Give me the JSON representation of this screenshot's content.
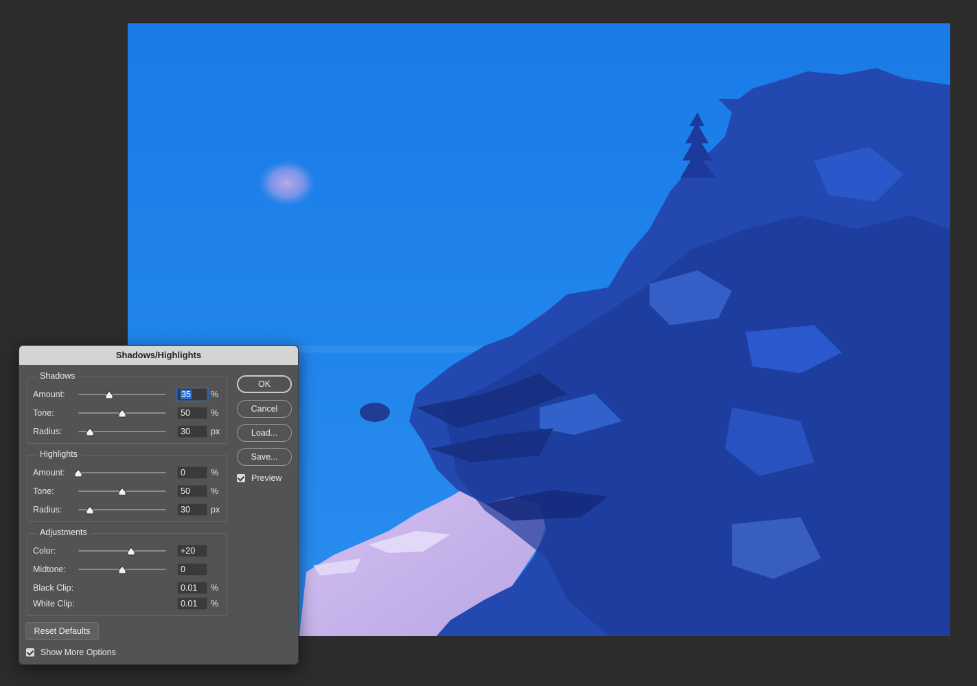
{
  "dialog": {
    "title": "Shadows/Highlights",
    "buttons": {
      "ok": "OK",
      "cancel": "Cancel",
      "load": "Load...",
      "save": "Save..."
    },
    "preview": {
      "label": "Preview",
      "checked": true
    },
    "reset_defaults": "Reset Defaults",
    "show_more_options": {
      "label": "Show More Options",
      "checked": true
    }
  },
  "shadows": {
    "label": "Shadows",
    "amount": {
      "label": "Amount:",
      "value": "35",
      "unit": "%",
      "slider_fraction": 0.35
    },
    "tone": {
      "label": "Tone:",
      "value": "50",
      "unit": "%",
      "slider_fraction": 0.5
    },
    "radius": {
      "label": "Radius:",
      "value": "30",
      "unit": "px",
      "slider_fraction": 0.13
    }
  },
  "highlights": {
    "label": "Highlights",
    "amount": {
      "label": "Amount:",
      "value": "0",
      "unit": "%",
      "slider_fraction": 0.0
    },
    "tone": {
      "label": "Tone:",
      "value": "50",
      "unit": "%",
      "slider_fraction": 0.5
    },
    "radius": {
      "label": "Radius:",
      "value": "30",
      "unit": "px",
      "slider_fraction": 0.13
    }
  },
  "adjustments": {
    "label": "Adjustments",
    "color": {
      "label": "Color:",
      "value": "+20",
      "slider_fraction": 0.6
    },
    "midtone": {
      "label": "Midtone:",
      "value": "0",
      "slider_fraction": 0.5
    },
    "black_clip": {
      "label": "Black Clip:",
      "value": "0.01",
      "unit": "%"
    },
    "white_clip": {
      "label": "White Clip:",
      "value": "0.01",
      "unit": "%"
    }
  },
  "colors": {
    "app_background": "#2c2c2c",
    "dialog_background": "#535353",
    "sky": "#1e7fe6",
    "rocks": "#1f3f9a",
    "sand": "#c9b3e8"
  }
}
